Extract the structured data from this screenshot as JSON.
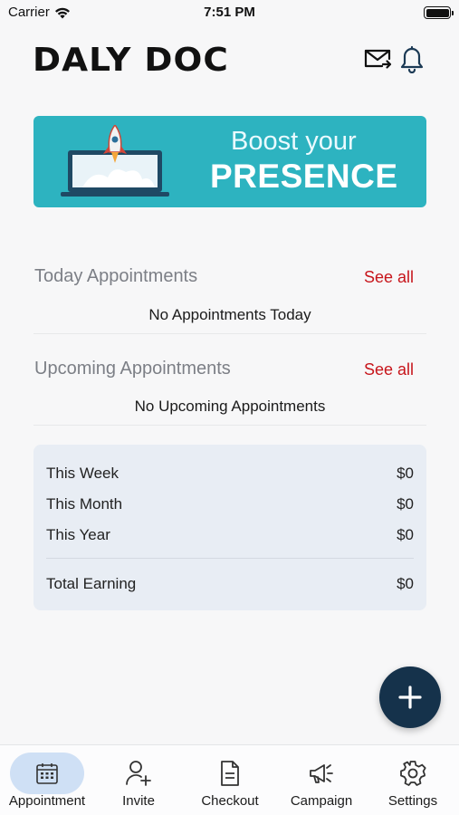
{
  "status_bar": {
    "carrier": "Carrier",
    "time": "7:51 PM"
  },
  "header": {
    "logo": "DALY DOC",
    "mail_icon": "mail-icon",
    "bell_icon": "bell-icon"
  },
  "banner": {
    "line1": "Boost your",
    "line2": "PRESENCE",
    "art_icon": "rocket-laptop-icon",
    "color": "#2db3c0"
  },
  "today": {
    "title": "Today Appointments",
    "see_all": "See all",
    "empty": "No Appointments Today"
  },
  "upcoming": {
    "title": "Upcoming Appointments",
    "see_all": "See all",
    "empty": "No Upcoming Appointments"
  },
  "earnings": {
    "rows": [
      {
        "label": "This Week",
        "value": "$0"
      },
      {
        "label": "This Month",
        "value": "$0"
      },
      {
        "label": "This Year",
        "value": "$0"
      }
    ],
    "total": {
      "label": "Total Earning",
      "value": "$0"
    }
  },
  "fab": {
    "icon": "plus-icon",
    "color": "#15324b"
  },
  "tabs": [
    {
      "label": "Appointment",
      "icon": "calendar-icon",
      "active": true
    },
    {
      "label": "Invite",
      "icon": "add-user-icon",
      "active": false
    },
    {
      "label": "Checkout",
      "icon": "document-icon",
      "active": false
    },
    {
      "label": "Campaign",
      "icon": "megaphone-icon",
      "active": false
    },
    {
      "label": "Settings",
      "icon": "gear-icon",
      "active": false
    }
  ],
  "colors": {
    "accent_red": "#c7151b",
    "active_tab_bg": "#cfe0f5",
    "earnings_bg": "#e8edf4"
  }
}
